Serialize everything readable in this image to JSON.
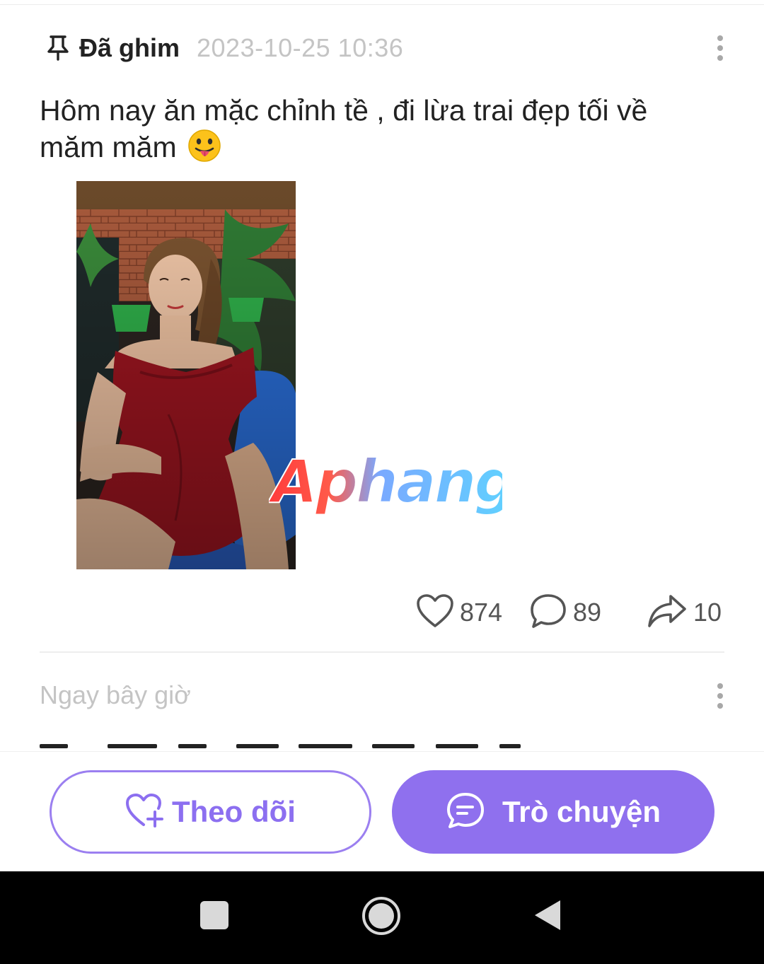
{
  "post": {
    "pinned_label": "Đã ghim",
    "timestamp": "2023-10-25 10:36",
    "text": "Hôm nay ăn mặc chỉnh tề , đi lừa trai đẹp tối về măm măm",
    "emoji_icon": "face-with-tongue-emoji",
    "watermark_text": "Aphang",
    "likes": "874",
    "comments": "89",
    "shares": "10"
  },
  "next_post": {
    "timestamp": "Ngay bây giờ"
  },
  "bottom_bar": {
    "follow_label": "Theo dõi",
    "chat_label": "Trò chuyện"
  },
  "icons": {
    "pin": "pin-icon",
    "more": "more-vertical-icon",
    "like": "heart-icon",
    "comment": "comment-icon",
    "share": "share-icon",
    "follow": "heart-plus-icon",
    "chat": "chat-bubble-icon",
    "nav_recent": "square-icon",
    "nav_home": "circle-icon",
    "nav_back": "triangle-back-icon"
  },
  "colors": {
    "accent": "#8f70ee",
    "muted_text": "#c4c4c4",
    "body_text": "#222222"
  }
}
